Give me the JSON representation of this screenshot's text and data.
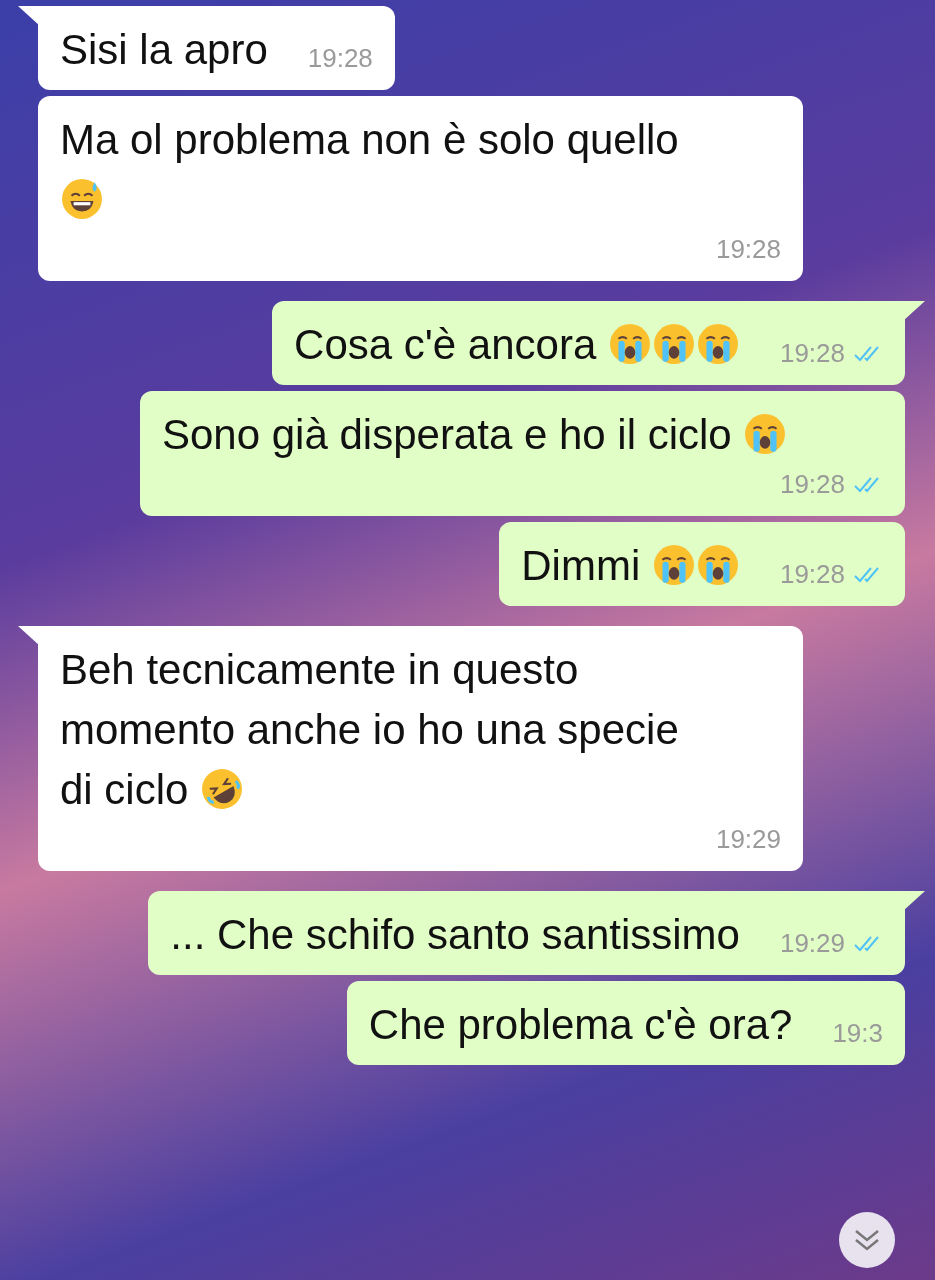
{
  "messages": [
    {
      "kind": "incoming",
      "tail": true,
      "text": "Sisi la apro",
      "time": "19:28",
      "read": false
    },
    {
      "kind": "incoming",
      "tail": false,
      "text": "Ma ol problema non è solo quello",
      "emojis": [
        {
          "kind": "sweat-smile"
        }
      ],
      "time": "19:28",
      "read": false
    },
    {
      "kind": "outgoing",
      "tail": true,
      "text": "Cosa c'è ancora",
      "emojis": [
        {
          "kind": "crying"
        },
        {
          "kind": "crying"
        },
        {
          "kind": "crying"
        }
      ],
      "time": "19:28",
      "read": true
    },
    {
      "kind": "outgoing",
      "tail": false,
      "text": "Sono già disperata e ho il ciclo",
      "emojis": [
        {
          "kind": "crying"
        }
      ],
      "time": "19:28",
      "read": true
    },
    {
      "kind": "outgoing",
      "tail": false,
      "text": "Dimmi",
      "emojis": [
        {
          "kind": "crying"
        },
        {
          "kind": "crying"
        }
      ],
      "time": "19:28",
      "read": true
    },
    {
      "kind": "incoming",
      "tail": true,
      "text": "Beh tecnicamente in questo momento anche io ho una specie di ciclo",
      "emojis": [
        {
          "kind": "rofl"
        }
      ],
      "time": "19:29",
      "read": false
    },
    {
      "kind": "outgoing",
      "tail": true,
      "text": "... Che schifo santo santissimo",
      "time": "19:29",
      "read": true
    },
    {
      "kind": "outgoing",
      "tail": false,
      "text": "Che problema c'è ora?",
      "time": "19:3",
      "read": false
    }
  ]
}
